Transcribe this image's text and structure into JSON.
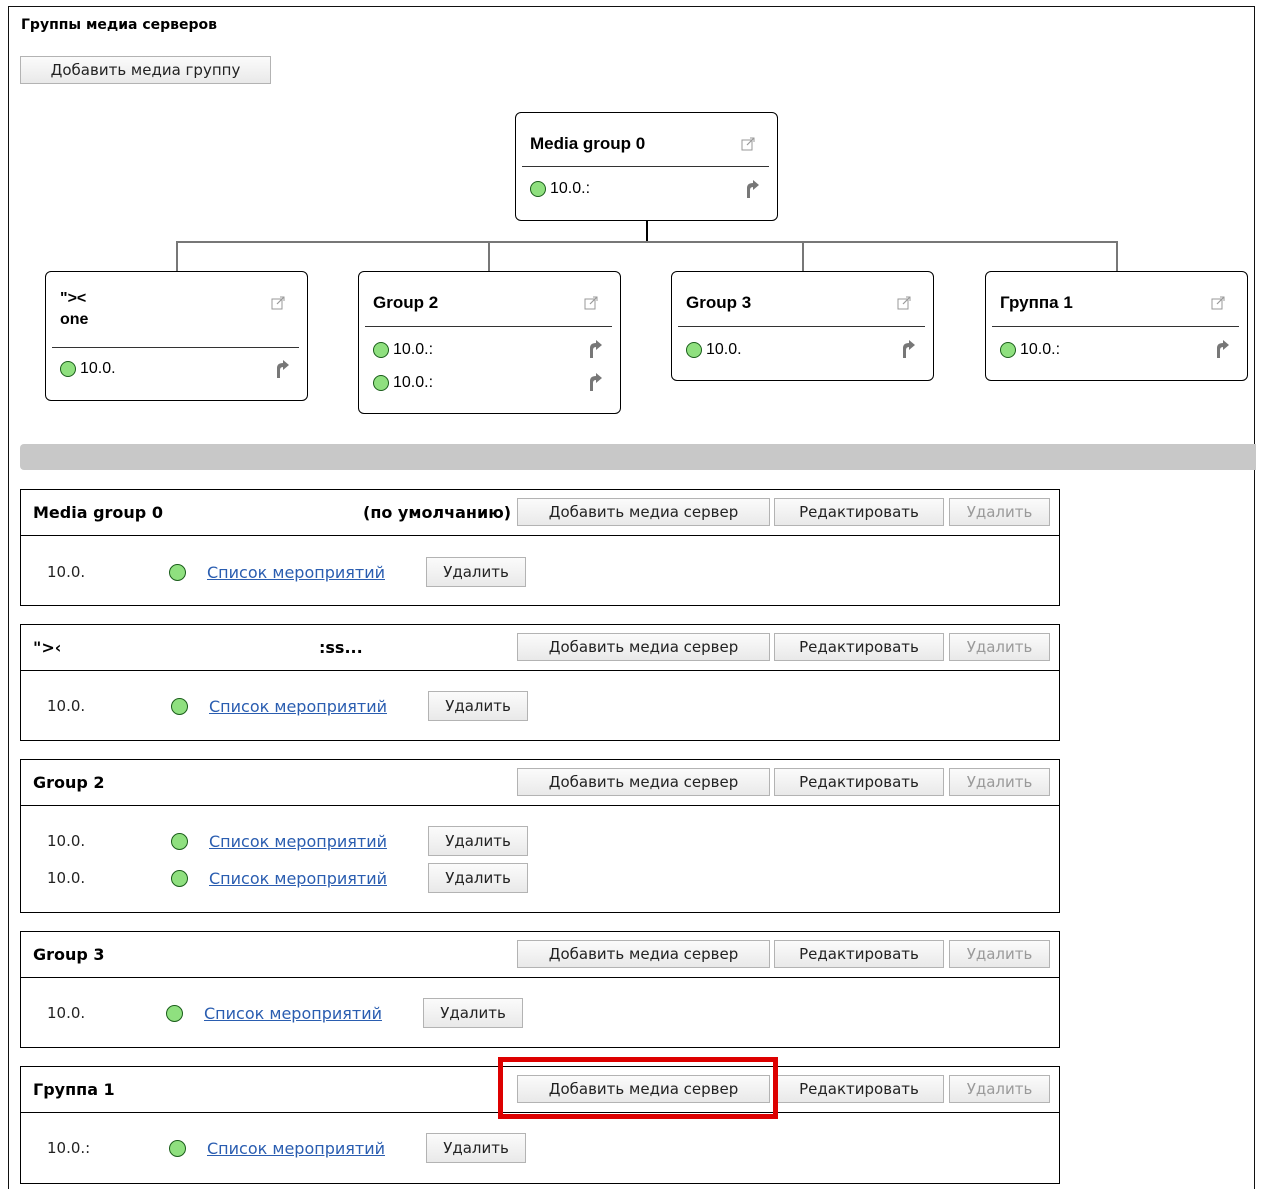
{
  "page_title": "Группы медиа серверов",
  "add_group_label": "Добавить медиа группу",
  "status_color": "#8fe07f",
  "tree": {
    "root": {
      "title": "Media group 0",
      "servers": [
        "10.0.:"
      ]
    },
    "children": [
      {
        "title": "\"><",
        "title_line2": "one",
        "servers": [
          "10.0."
        ]
      },
      {
        "title": "Group 2",
        "servers": [
          "10.0.:",
          "10.0.:"
        ]
      },
      {
        "title": "Group 3",
        "servers": [
          "10.0."
        ]
      },
      {
        "title": "Группа 1",
        "servers": [
          "10.0.:"
        ]
      }
    ]
  },
  "buttons": {
    "add_server": "Добавить медиа сервер",
    "edit": "Редактировать",
    "delete": "Удалить",
    "events_list": "Список мероприятий",
    "delete_server": "Удалить"
  },
  "groups": [
    {
      "name": "Media group 0",
      "default_label": "(по умолчанию)",
      "servers": [
        "10.0."
      ]
    },
    {
      "name": "\">‹",
      "name_suffix": ":ss...",
      "servers": [
        "10.0."
      ]
    },
    {
      "name": "Group 2",
      "servers": [
        "10.0.",
        "10.0."
      ]
    },
    {
      "name": "Group 3",
      "servers": [
        "10.0."
      ]
    },
    {
      "name": "Группа 1",
      "servers": [
        "10.0.:"
      ]
    }
  ]
}
